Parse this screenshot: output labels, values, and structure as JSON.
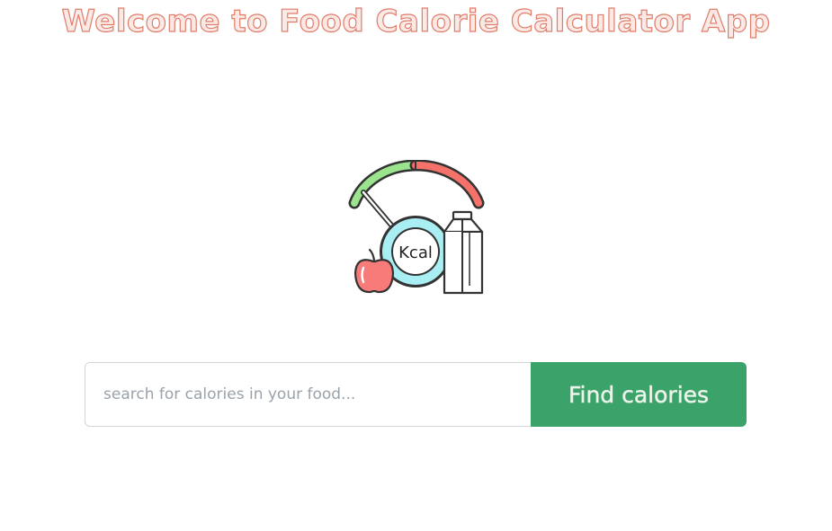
{
  "header": {
    "title": "Welcome to Food Calorie Calculator App"
  },
  "logo": {
    "badge_text": "Kcal",
    "icon": "calorie-meter-icon"
  },
  "search": {
    "placeholder": "search for calories in your food...",
    "value": "",
    "button_label": "Find calories"
  },
  "colors": {
    "title": "#e07d6a",
    "button": "#3ba36a",
    "gauge_green": "#9be38d",
    "gauge_red": "#f5726a",
    "lens_ring": "#a8eef2",
    "apple": "#f77b78"
  }
}
